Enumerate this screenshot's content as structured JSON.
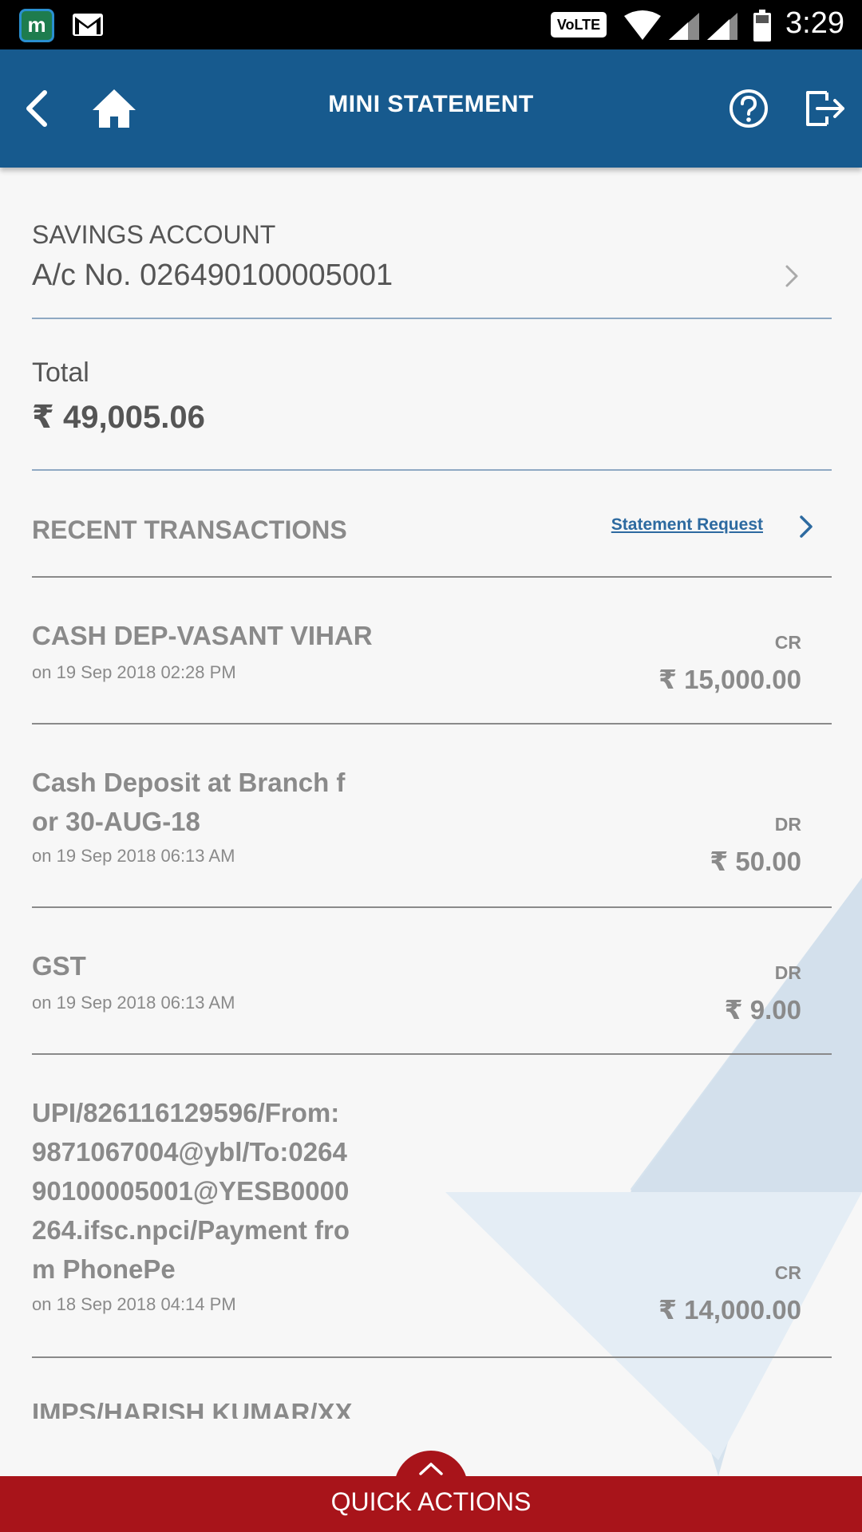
{
  "status_bar": {
    "app_icon_letter": "m",
    "network_label": "VoLTE",
    "time": "3:29"
  },
  "header": {
    "title": "MINI STATEMENT"
  },
  "account": {
    "type": "SAVINGS ACCOUNT",
    "number": "A/c No. 026490100005001"
  },
  "total": {
    "label": "Total",
    "amount": "₹ 49,005.06"
  },
  "recent": {
    "label": "RECENT TRANSACTIONS",
    "statement_link": "Statement Request"
  },
  "transactions": [
    {
      "desc": "CASH DEP-VASANT VIHAR",
      "date": "on 19 Sep 2018 02:28 PM",
      "type": "CR",
      "amount": "₹ 15,000.00"
    },
    {
      "desc": "Cash Deposit at Branch f\nor 30-AUG-18",
      "date": "on 19 Sep 2018 06:13 AM",
      "type": "DR",
      "amount": "₹ 50.00"
    },
    {
      "desc": "GST",
      "date": "on 19 Sep 2018 06:13 AM",
      "type": "DR",
      "amount": "₹ 9.00"
    },
    {
      "desc": "UPI/826116129596/From:9871067004@ybl/To:026490100005001@YESB0000264.ifsc.npci/Payment from PhonePe",
      "date": "on 18 Sep 2018 04:14 PM",
      "type": "CR",
      "amount": "₹ 14,000.00"
    },
    {
      "desc": "IMPS/HARISH KUMAR/XX",
      "date": "",
      "type": "",
      "amount": ""
    }
  ],
  "quick_actions": {
    "label": "QUICK ACTIONS"
  },
  "colors": {
    "header_bg": "#175a8e",
    "quick_actions_bg": "#a8141a",
    "link": "#2d6aa0",
    "muted_text": "#8a8a8a"
  }
}
